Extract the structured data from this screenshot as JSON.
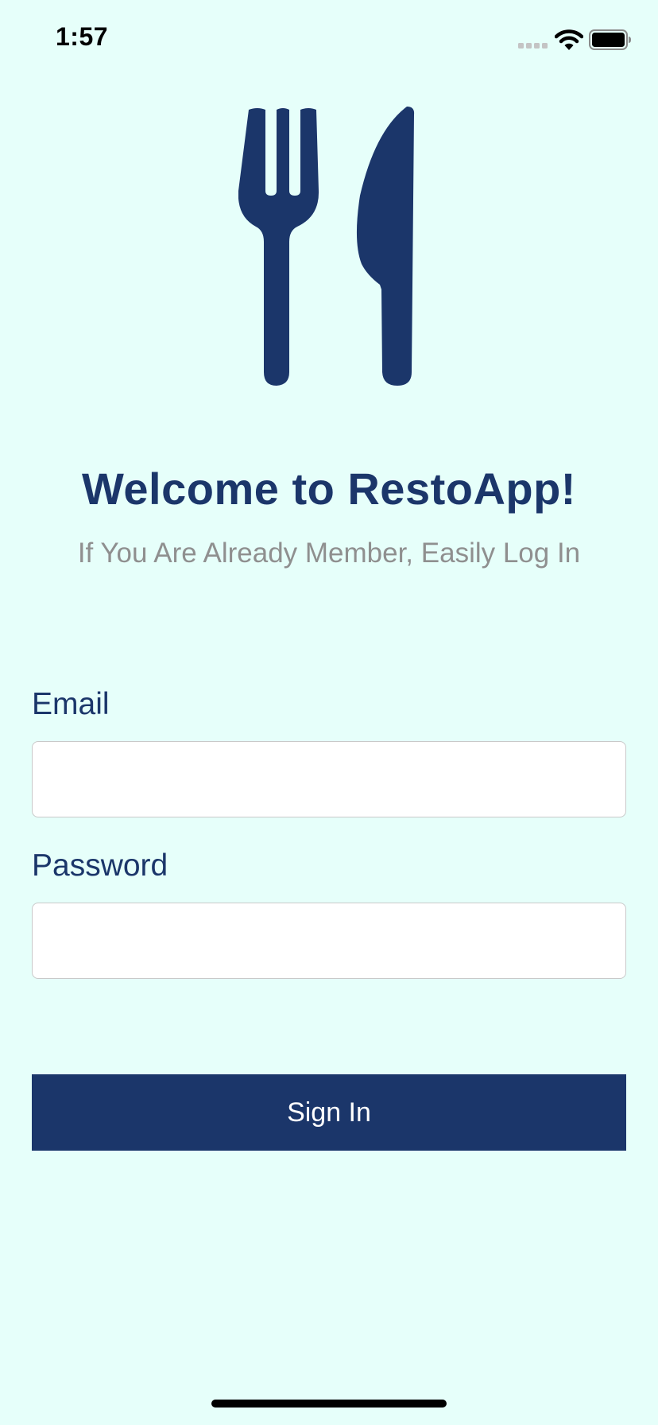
{
  "status_bar": {
    "time": "1:57",
    "icons": [
      "signal-icon",
      "wifi-icon",
      "battery-icon"
    ]
  },
  "logo": {
    "icon": "fork-knife-icon",
    "color": "#1b366a"
  },
  "welcome": {
    "title": "Welcome to RestoApp!",
    "subtitle": "If You Are Already Member, Easily Log In"
  },
  "form": {
    "email_label": "Email",
    "email_value": "",
    "email_placeholder": "",
    "password_label": "Password",
    "password_value": "",
    "password_placeholder": "",
    "sign_in_label": "Sign In"
  },
  "colors": {
    "background": "#e6fffa",
    "primary": "#1b366a",
    "subtitle": "#8f8f8f",
    "button_text": "#ffffff"
  }
}
